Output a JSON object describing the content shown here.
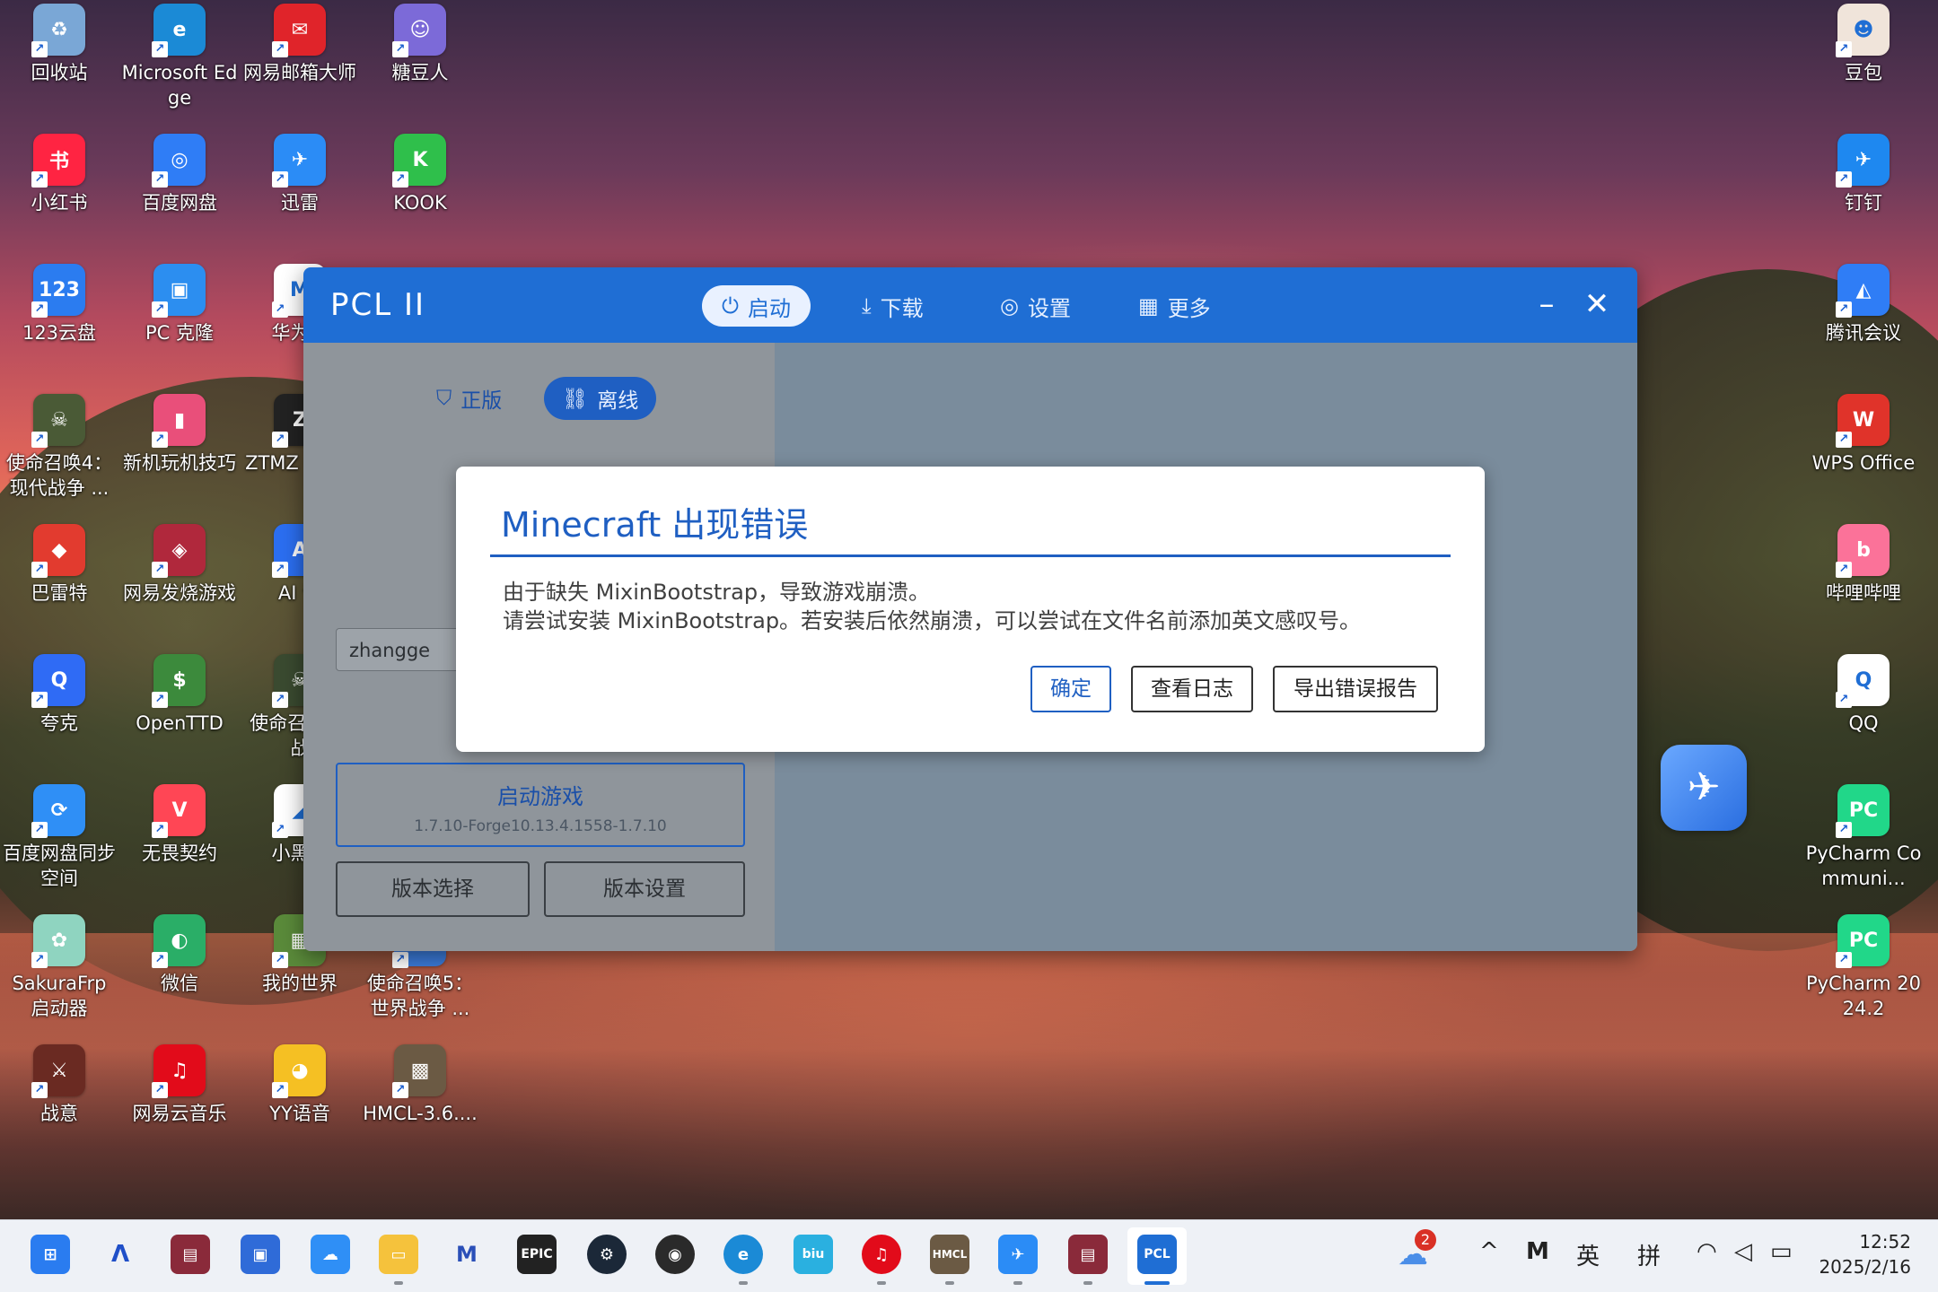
{
  "desktop_left": [
    {
      "label": "回收站",
      "icon": "recycle-bin-icon",
      "color": "#7aa7d6",
      "glyph": "♻"
    },
    {
      "label": "Microsoft Edge",
      "icon": "edge-icon",
      "color": "#1b8ad6",
      "glyph": "e"
    },
    {
      "label": "网易邮箱大师",
      "icon": "netease-mail-icon",
      "color": "#e0242a",
      "glyph": "✉"
    },
    {
      "label": "糖豆人",
      "icon": "fall-guys-icon",
      "color": "#7c6ad8",
      "glyph": "☺"
    },
    {
      "label": "小红书",
      "icon": "xiaohongshu-icon",
      "color": "#ff2442",
      "glyph": "书"
    },
    {
      "label": "百度网盘",
      "icon": "baidu-netdisk-icon",
      "color": "#2f7df6",
      "glyph": "◎"
    },
    {
      "label": "迅雷",
      "icon": "xunlei-icon",
      "color": "#2b8cf6",
      "glyph": "✈"
    },
    {
      "label": "KOOK",
      "icon": "kook-icon",
      "color": "#2fbf4b",
      "glyph": "K"
    },
    {
      "label": "123云盘",
      "icon": "123-cloud-icon",
      "color": "#2b7cf0",
      "glyph": "123"
    },
    {
      "label": "PC 克隆",
      "icon": "pc-clone-icon",
      "color": "#2c8ef0",
      "glyph": "▣"
    },
    {
      "label": "华为电",
      "icon": "huawei-pc-icon",
      "color": "#ffffff",
      "glyph": "M"
    },
    {
      "label": "使命召唤4：现代战争 ...",
      "icon": "cod4-icon",
      "color": "#4a5a36",
      "glyph": "☠"
    },
    {
      "label": "新机玩机技巧",
      "icon": "phone-tips-icon",
      "color": "#e94f7a",
      "glyph": "▮"
    },
    {
      "label": "ZTMZ Gene",
      "icon": "ztmz-icon",
      "color": "#222222",
      "glyph": "Z"
    },
    {
      "label": "巴雷特",
      "icon": "barrett-icon",
      "color": "#e23b2f",
      "glyph": "◆"
    },
    {
      "label": "网易发烧游戏",
      "icon": "netease-games-icon",
      "color": "#b0283c",
      "glyph": "◈"
    },
    {
      "label": "AI 音",
      "icon": "ai-icon",
      "color": "#2b6ef0",
      "glyph": "A"
    },
    {
      "label": "夸克",
      "icon": "quark-icon",
      "color": "#2f6bf5",
      "glyph": "Q"
    },
    {
      "label": "OpenTTD",
      "icon": "openttd-icon",
      "color": "#3c8a3c",
      "glyph": "$"
    },
    {
      "label": "使命召 现代战",
      "icon": "cod-icon",
      "color": "#3a4a30",
      "glyph": "☠"
    },
    {
      "label": "百度网盘同步空间",
      "icon": "baidu-sync-icon",
      "color": "#2f8ff6",
      "glyph": "⟳"
    },
    {
      "label": "无畏契约",
      "icon": "valorant-icon",
      "color": "#ff4655",
      "glyph": "V"
    },
    {
      "label": "小黑盒",
      "icon": "heybox-icon",
      "color": "#ffffff",
      "glyph": "◢"
    },
    {
      "label": "SakuraFrp 启动器",
      "icon": "sakurafrp-icon",
      "color": "#8fd4c0",
      "glyph": "✿"
    },
    {
      "label": "微信",
      "icon": "wechat-icon",
      "color": "#2aae67",
      "glyph": "◐"
    },
    {
      "label": "我的世界",
      "icon": "minecraft-icon",
      "color": "#5a8a3a",
      "glyph": "▦"
    },
    {
      "label": "使命召唤5：世界战争 ...",
      "icon": "cod5-icon",
      "color": "#3a7ad8",
      "glyph": "☠"
    },
    {
      "label": "战意",
      "icon": "conquerors-blade-icon",
      "color": "#6a2a22",
      "glyph": "⚔"
    },
    {
      "label": "网易云音乐",
      "icon": "netease-music-icon",
      "color": "#e20b1a",
      "glyph": "♫"
    },
    {
      "label": "YY语音",
      "icon": "yy-icon",
      "color": "#f5c023",
      "glyph": "◕"
    },
    {
      "label": "HMCL-3.6....",
      "icon": "hmcl-icon",
      "color": "#6b5a44",
      "glyph": "▩"
    }
  ],
  "desktop_right": [
    {
      "label": "豆包",
      "icon": "doubao-icon",
      "color": "#f0e4da",
      "glyph": "☻"
    },
    {
      "label": "钉钉",
      "icon": "dingtalk-icon",
      "color": "#1e88f0",
      "glyph": "✈"
    },
    {
      "label": "腾讯会议",
      "icon": "tencent-meeting-icon",
      "color": "#2f7df6",
      "glyph": "◭"
    },
    {
      "label": "WPS Office",
      "icon": "wps-icon",
      "color": "#e0332a",
      "glyph": "W"
    },
    {
      "label": "哔哩哔哩",
      "icon": "bilibili-icon",
      "color": "#fb7299",
      "glyph": "b"
    },
    {
      "label": "QQ",
      "icon": "qq-icon",
      "color": "#ffffff",
      "glyph": "Q"
    },
    {
      "label": "PyCharm Communi...",
      "icon": "pycharm-ce-icon",
      "color": "#21d789",
      "glyph": "PC"
    },
    {
      "label": "PyCharm 2024.2",
      "icon": "pycharm-icon",
      "color": "#21d789",
      "glyph": "PC"
    }
  ],
  "pcl": {
    "logo": "PCL II",
    "nav": {
      "launch": "启动",
      "download": "下载",
      "settings": "设置",
      "more": "更多"
    },
    "auth": {
      "official": "正版",
      "offline": "离线"
    },
    "username": "zhangge",
    "launch_title": "启动游戏",
    "launch_version": "1.7.10-Forge10.13.4.1558-1.7.10",
    "version_select": "版本选择",
    "version_settings": "版本设置"
  },
  "dialog": {
    "title": "Minecraft 出现错误",
    "line1": "由于缺失 MixinBootstrap，导致游戏崩溃。",
    "line2": "请尝试安装 MixinBootstrap。若安装后依然崩溃，可以尝试在文件名前添加英文感叹号。",
    "ok": "确定",
    "view_log": "查看日志",
    "export_report": "导出错误报告"
  },
  "taskbar": {
    "tray_ime1": "英",
    "tray_ime2": "拼",
    "time": "12:52",
    "date": "2025/2/16",
    "weather_badge": "2"
  }
}
